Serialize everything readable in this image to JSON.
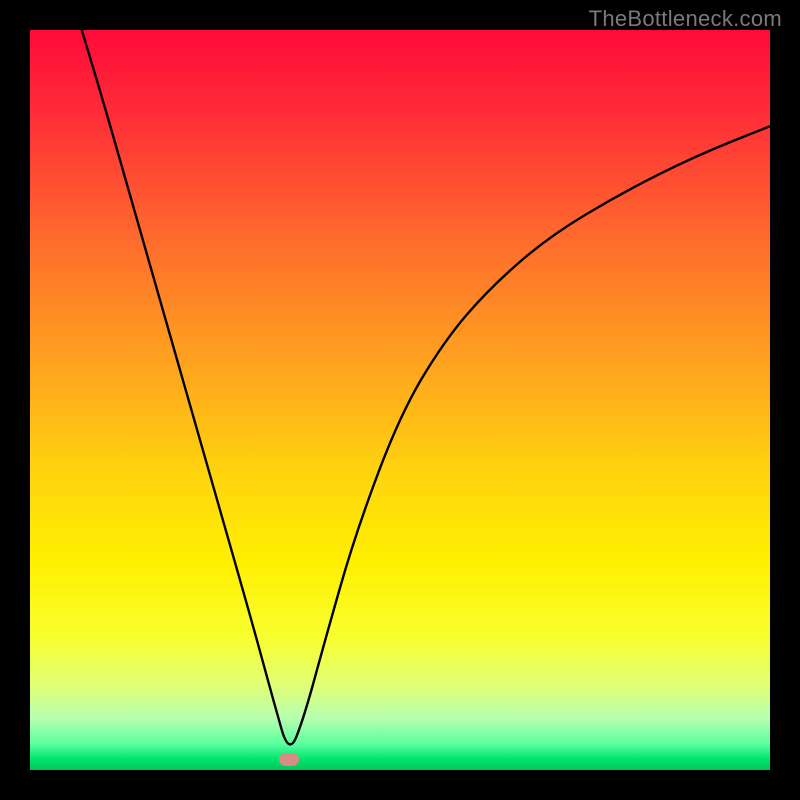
{
  "watermark": "TheBottleneck.com",
  "chart_data": {
    "type": "line",
    "title": "",
    "xlabel": "",
    "ylabel": "",
    "x_range": [
      0,
      100
    ],
    "y_range": [
      0,
      100
    ],
    "minimum_at_x": 35,
    "series": [
      {
        "name": "bottleneck-curve",
        "x": [
          7,
          10,
          14,
          18,
          22,
          26,
          30,
          33,
          35,
          37,
          40,
          44,
          50,
          56,
          62,
          70,
          80,
          90,
          100
        ],
        "y": [
          100,
          90,
          76,
          62,
          48,
          34,
          20,
          9,
          2,
          7,
          18,
          32,
          48,
          58,
          65,
          72,
          78,
          83,
          87
        ]
      }
    ],
    "marker": {
      "x": 35,
      "y": 1.5,
      "color": "#d98b86"
    },
    "gradient_stops": [
      {
        "pos": 0.0,
        "color": "#ff0a3a"
      },
      {
        "pos": 0.12,
        "color": "#ff2f37"
      },
      {
        "pos": 0.28,
        "color": "#ff6a2d"
      },
      {
        "pos": 0.45,
        "color": "#ffa31f"
      },
      {
        "pos": 0.6,
        "color": "#ffd40e"
      },
      {
        "pos": 0.72,
        "color": "#fff000"
      },
      {
        "pos": 0.82,
        "color": "#f8ff2f"
      },
      {
        "pos": 0.88,
        "color": "#e4ff70"
      },
      {
        "pos": 0.93,
        "color": "#b6ffb0"
      },
      {
        "pos": 0.965,
        "color": "#5aff9e"
      },
      {
        "pos": 0.985,
        "color": "#00e56f"
      },
      {
        "pos": 1.0,
        "color": "#00c853"
      }
    ]
  }
}
